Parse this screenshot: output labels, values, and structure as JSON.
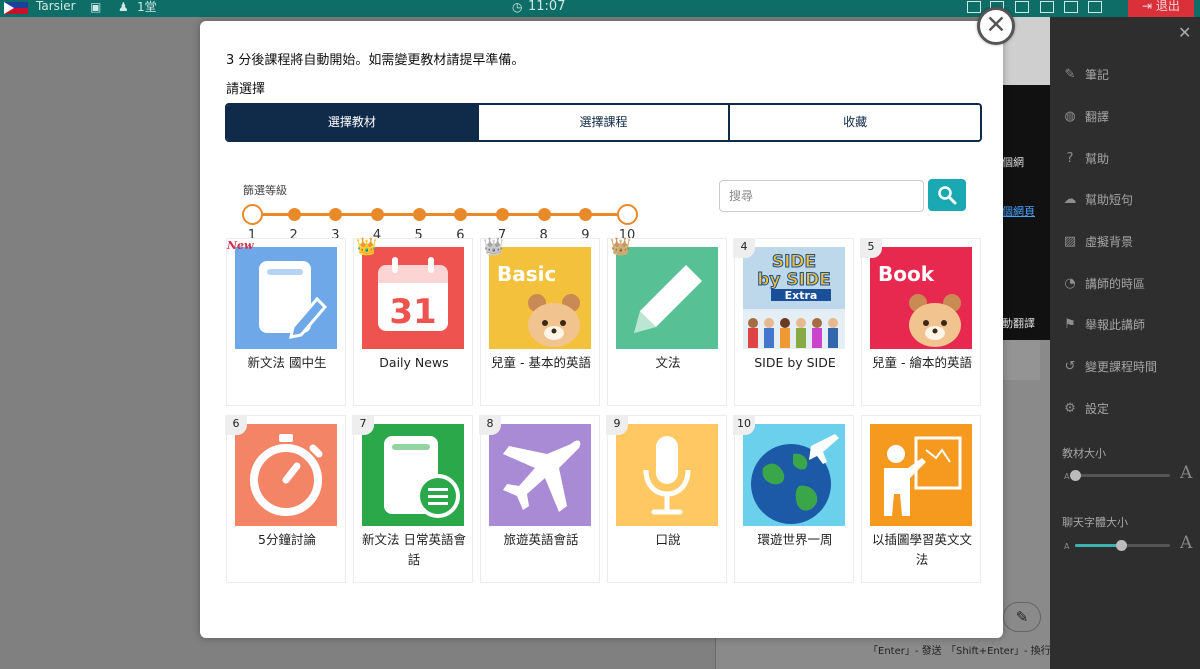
{
  "topbar": {
    "teacher_name": "Tarsier",
    "count": "1堂",
    "timer": "11:07",
    "exit_label": "退出"
  },
  "background": {
    "snippet_1": "個網",
    "link_1": "個網頁",
    "snippet_2": "動翻譯",
    "hint_send": "「Enter」- 發送",
    "hint_newline": "「Shift+Enter」- 換行"
  },
  "sidebar": {
    "items": [
      {
        "icon": "edit-icon",
        "label": "筆記"
      },
      {
        "icon": "globe-icon",
        "label": "翻譯"
      },
      {
        "icon": "help-icon",
        "label": "幫助"
      },
      {
        "icon": "chat-icon",
        "label": "幫助短句"
      },
      {
        "icon": "image-icon",
        "label": "虛擬背景"
      },
      {
        "icon": "clock-globe-icon",
        "label": "講師的時區"
      },
      {
        "icon": "flag-icon",
        "label": "舉報此講師"
      },
      {
        "icon": "schedule-icon",
        "label": "變更課程時間"
      },
      {
        "icon": "gear-icon",
        "label": "設定"
      }
    ],
    "material_size_label": "教材大小",
    "chat_size_label": "聊天字體大小",
    "material_size_value": 0.0,
    "chat_size_value": 0.48
  },
  "modal": {
    "notice": "3 分後課程將自動開始。如需變更教材請提早準備。",
    "select_title": "請選擇",
    "tabs": [
      {
        "label": "選擇教材",
        "active": true
      },
      {
        "label": "選擇課程",
        "active": false
      },
      {
        "label": "收藏",
        "active": false
      }
    ],
    "filter_label": "篩選等級",
    "levels": [
      "1",
      "2",
      "3",
      "4",
      "5",
      "6",
      "7",
      "8",
      "9",
      "10"
    ],
    "level_range": [
      1,
      10
    ],
    "search_placeholder": "搜尋",
    "materials": [
      {
        "title": "新文法 國中生",
        "level": "",
        "badge": "New",
        "color": "#6fa8e8",
        "thumb": "notebook-pen"
      },
      {
        "title": "Daily News",
        "level": "",
        "badge": "gold-crown",
        "color": "#ef5350",
        "thumb": "calendar-31",
        "thumb_text": "31"
      },
      {
        "title": "兒童 - 基本的英語",
        "level": "",
        "badge": "silver-crown",
        "color": "#f4c13d",
        "thumb": "basic-bear",
        "thumb_text": "Basic"
      },
      {
        "title": "文法",
        "level": "",
        "badge": "bronze-crown",
        "color": "#57c094",
        "thumb": "pencil"
      },
      {
        "title": "SIDE by SIDE",
        "level": "4",
        "badge": "",
        "color": "#cfe3ef",
        "thumb": "side-by-side-book",
        "thumb_text": "SIDE by SIDE Extra"
      },
      {
        "title": "兒童 - 繪本的英語",
        "level": "5",
        "badge": "",
        "color": "#e8294f",
        "thumb": "book-bear",
        "thumb_text": "Book"
      },
      {
        "title": "5分鐘討論",
        "level": "6",
        "badge": "",
        "color": "#f38466",
        "thumb": "stopwatch"
      },
      {
        "title": "新文法 日常英語會話",
        "level": "7",
        "badge": "",
        "color": "#2aa84a",
        "thumb": "notebook-chat"
      },
      {
        "title": "旅遊英語會話",
        "level": "8",
        "badge": "",
        "color": "#a98ad4",
        "thumb": "airplane"
      },
      {
        "title": "口說",
        "level": "9",
        "badge": "",
        "color": "#ffc862",
        "thumb": "microphone"
      },
      {
        "title": "環遊世界一周",
        "level": "10",
        "badge": "",
        "color": "#6ad0ec",
        "thumb": "globe-plane"
      },
      {
        "title": "以插圖學習英文文法",
        "level": "",
        "badge": "",
        "color": "#f59a1e",
        "thumb": "teacher-board"
      }
    ]
  }
}
